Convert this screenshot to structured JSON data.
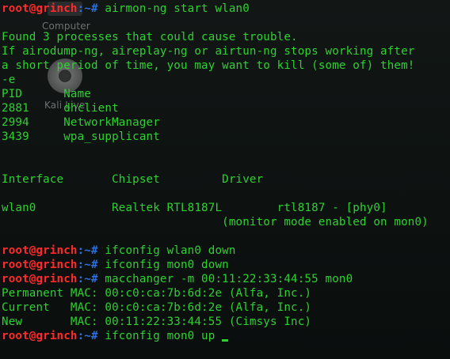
{
  "desktop": {
    "computer_label": "Computer",
    "kali_label": "Kali Live"
  },
  "prompt": {
    "user_host": "root@grinch",
    "separator": ":~#"
  },
  "colors": {
    "background": "#0e1312",
    "text": "#2fd032",
    "prompt_user": "#ff2a2a",
    "prompt_path": "#2b6fe0"
  },
  "lines": [
    {
      "type": "prompt",
      "cmd": " airmon-ng start wlan0"
    },
    {
      "type": "blank",
      "text": ""
    },
    {
      "type": "text",
      "text": "Found 3 processes that could cause trouble."
    },
    {
      "type": "text",
      "text": "If airodump-ng, aireplay-ng or airtun-ng stops working after"
    },
    {
      "type": "text",
      "text": "a short period of time, you may want to kill (some of) them!"
    },
    {
      "type": "text",
      "text": "-e"
    },
    {
      "type": "text",
      "text": "PID      Name"
    },
    {
      "type": "text",
      "text": "2881     dhclient"
    },
    {
      "type": "text",
      "text": "2994     NetworkManager"
    },
    {
      "type": "text",
      "text": "3439     wpa_supplicant"
    },
    {
      "type": "blank",
      "text": ""
    },
    {
      "type": "blank",
      "text": ""
    },
    {
      "type": "text",
      "text": "Interface       Chipset         Driver"
    },
    {
      "type": "blank",
      "text": ""
    },
    {
      "type": "text",
      "text": "wlan0           Realtek RTL8187L        rtl8187 - [phy0]"
    },
    {
      "type": "text",
      "text": "                                (monitor mode enabled on mon0)"
    },
    {
      "type": "blank",
      "text": ""
    },
    {
      "type": "prompt",
      "cmd": " ifconfig wlan0 down"
    },
    {
      "type": "prompt",
      "cmd": " ifconfig mon0 down"
    },
    {
      "type": "prompt",
      "cmd": " macchanger -m 00:11:22:33:44:55 mon0"
    },
    {
      "type": "text",
      "text": "Permanent MAC: 00:c0:ca:7b:6d:2e (Alfa, Inc.)"
    },
    {
      "type": "text",
      "text": "Current   MAC: 00:c0:ca:7b:6d:2e (Alfa, Inc.)"
    },
    {
      "type": "text",
      "text": "New       MAC: 00:11:22:33:44:55 (Cimsys Inc)"
    },
    {
      "type": "prompt",
      "cmd": " ifconfig mon0 up",
      "cursor": true
    }
  ]
}
